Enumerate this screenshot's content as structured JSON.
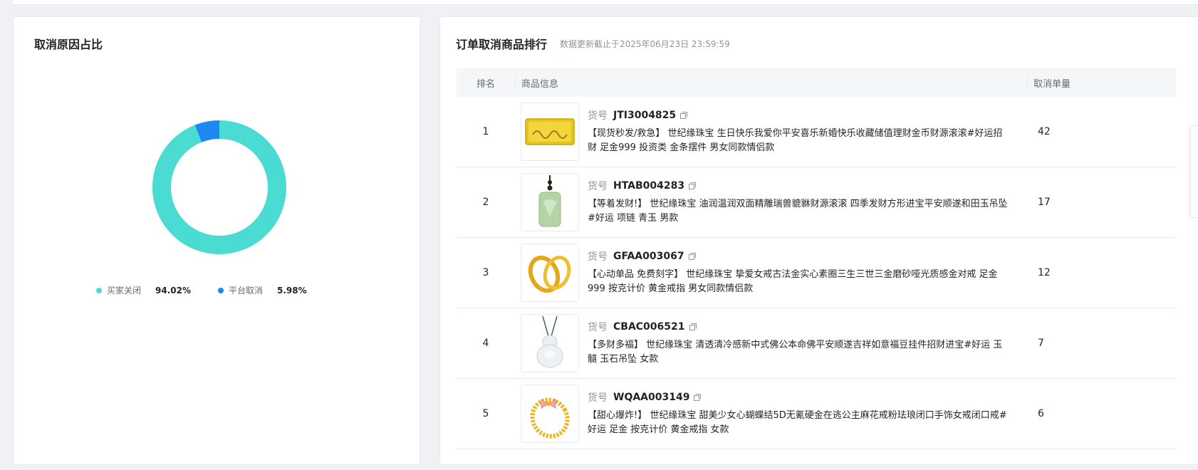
{
  "cancel_reason": {
    "title": "取消原因占比",
    "legend": [
      {
        "label": "买家关闭",
        "value": "94.02%",
        "percent": 94.02,
        "color": "#4adbd2"
      },
      {
        "label": "平台取消",
        "value": "5.98%",
        "percent": 5.98,
        "color": "#1e88f5"
      }
    ]
  },
  "ranking": {
    "title": "订单取消商品排行",
    "update_note": "数据更新截止于2025年06月23日 23:59:59",
    "columns": {
      "rank": "排名",
      "info": "商品信息",
      "count": "取消单量"
    },
    "sku_label": "货号",
    "rows": [
      {
        "rank": "1",
        "sku": "JTI3004825",
        "title": "【现货秒发/救急】 世纪缘珠宝 生日快乐我爱你平安喜乐新婚快乐收藏储值理财金币财源滚滚#好运招财 足金999 投资类 金条摆件 男女同款情侣款",
        "count": "42",
        "thumb_icon": "gold-bar-thumbnail"
      },
      {
        "rank": "2",
        "sku": "HTAB004283",
        "title": "【等着发财!】 世纪缘珠宝 油润温润双面精雕瑞兽貔貅财源滚滚 四季发财方形进宝平安顺遂和田玉吊坠#好运 项链 青玉 男款",
        "count": "17",
        "thumb_icon": "jade-pendant-thumbnail"
      },
      {
        "rank": "3",
        "sku": "GFAA003067",
        "title": "【心动单品 免费刻字】 世纪缘珠宝 挚爱女戒古法金实心素圈三生三世三金磨砂哑光质感金对戒 足金999 按克计价 黄金戒指 男女同款情侣款",
        "count": "12",
        "thumb_icon": "gold-rings-thumbnail"
      },
      {
        "rank": "4",
        "sku": "CBAC006521",
        "title": "【多财多福】 世纪缘珠宝 清透清冷感新中式佛公本命佛平安顺遂吉祥如意福豆挂件招财进宝#好运 玉髓 玉石吊坠 女款",
        "count": "7",
        "thumb_icon": "buddha-pendant-thumbnail"
      },
      {
        "rank": "5",
        "sku": "WQAA003149",
        "title": "【甜心爆炸!】 世纪缘珠宝 甜美少女心蝴蝶结5D无氰硬金在逃公主麻花戒粉珐琅闭口手饰女戒闭口戒#好运 足金 按克计价 黄金戒指 女款",
        "count": "6",
        "thumb_icon": "bow-ring-thumbnail"
      }
    ]
  },
  "chart_data": {
    "type": "pie",
    "title": "取消原因占比",
    "categories": [
      "买家关闭",
      "平台取消"
    ],
    "values": [
      94.02,
      5.98
    ],
    "colors": [
      "#4adbd2",
      "#1e88f5"
    ],
    "legend": "bottom"
  }
}
